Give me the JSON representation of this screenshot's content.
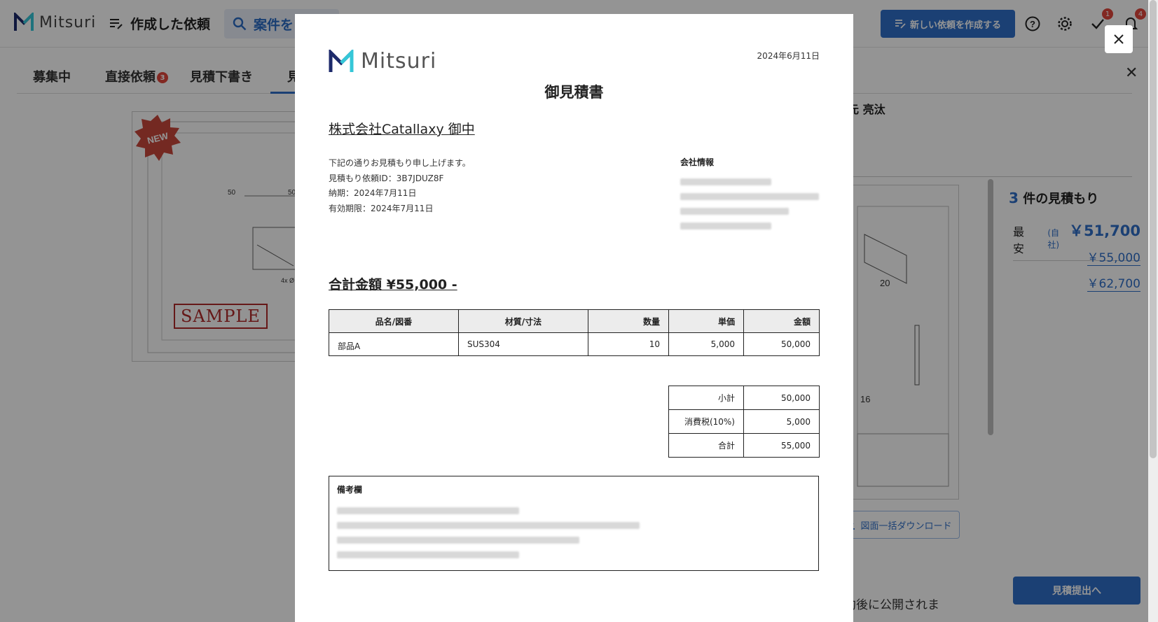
{
  "app": {
    "logo_text": "Mitsuri",
    "nav_title": "作成した依頼",
    "search_label": "案件を",
    "new_request_label": "新しい依頼を作成する",
    "check_badge": "1",
    "bell_badge": "4"
  },
  "tabs": [
    {
      "label": "募集中"
    },
    {
      "label": "直接依頼",
      "badge": "3"
    },
    {
      "label": "見積下書き"
    },
    {
      "label": "見"
    }
  ],
  "background": {
    "new_label": "NEW",
    "sample_label": "SAMPLE",
    "right_name": "元 亮汰",
    "download_label": "図面一括ダウンロード",
    "bottom_text": "約後に公開されま",
    "quotes_count": "3",
    "quotes_label": "件の見積もり",
    "cheapest_label": "最安",
    "self_label": "(自社)",
    "prices": [
      "￥51,700",
      "￥55,000",
      "￥62,700"
    ],
    "submit_label": "見積提出へ",
    "dim_labels": [
      "50",
      "50",
      "4x Ø"
    ],
    "right_dims": [
      "20",
      "16"
    ]
  },
  "modal": {
    "logo_text": "Mitsuri",
    "date": "2024年6月11日",
    "title": "御見積書",
    "client": "株式会社Catallaxy 御中",
    "intro": "下記の通りお見積もり申し上げます。",
    "request_id": "見積もり依頼ID：3B7JDUZ8F",
    "delivery": "納期：2024年7月11日",
    "validity": "有効期限：2024年7月11日",
    "company_info_label": "会社情報",
    "total": "合計金額 ¥55,000 -",
    "table": {
      "headers": [
        "品名/図番",
        "材質/寸法",
        "数量",
        "単価",
        "金額"
      ],
      "rows": [
        [
          "部品A",
          "SUS304",
          "10",
          "5,000",
          "50,000"
        ]
      ]
    },
    "summary": [
      {
        "label": "小計",
        "value": "50,000"
      },
      {
        "label": "消費税(10%)",
        "value": "5,000"
      },
      {
        "label": "合計",
        "value": "55,000"
      }
    ],
    "remarks_label": "備考欄"
  },
  "colors": {
    "accent": "#2f6fc9",
    "badge": "#e0453b",
    "overlay": "rgba(0,0,0,0.42)"
  }
}
